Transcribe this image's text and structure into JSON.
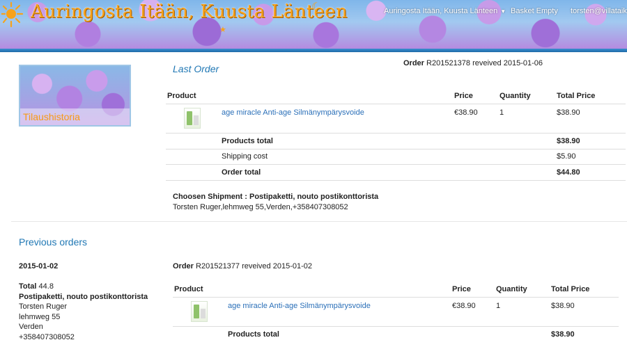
{
  "header": {
    "site_title": "Auringosta Itään, Kuusta Länteen",
    "nav_site": "Auringosta Itään, Kuusta Länteen",
    "nav_basket": "Basket Empty",
    "nav_user": "torsten@villataika.fi"
  },
  "sidebar": {
    "caption": "Tilaushistoria"
  },
  "last_order": {
    "title": "Last Order",
    "order_label": "Order",
    "order_text": "R201521378 reveived 2015-01-06",
    "columns": {
      "product": "Product",
      "price": "Price",
      "quantity": "Quantity",
      "total": "Total Price"
    },
    "items": [
      {
        "name": "age miracle Anti-age Silmänympärysvoide",
        "price": "€38.90",
        "quantity": "1",
        "total": "$38.90"
      }
    ],
    "products_total_label": "Products total",
    "products_total": "$38.90",
    "shipping_label": "Shipping cost",
    "shipping": "$5.90",
    "order_total_label": "Order total",
    "order_total": "$44.80",
    "shipment_label": "Choosen Shipment : Postipaketti, nouto postikonttorista",
    "shipment_address": "Torsten Ruger,lehmweg 55,Verden,+358407308052"
  },
  "previous": {
    "title": "Previous orders",
    "date": "2015-01-02",
    "total_label": "Total",
    "total_value": "44.8",
    "shipping_method": "Postipaketti, nouto postikonttorista",
    "address_lines": [
      "Torsten Ruger",
      "lehmweg 55",
      "Verden",
      "+358407308052"
    ],
    "order_label": "Order",
    "order_text": "R201521377 reveived 2015-01-02",
    "columns": {
      "product": "Product",
      "price": "Price",
      "quantity": "Quantity",
      "total": "Total Price"
    },
    "items": [
      {
        "name": "age miracle Anti-age Silmänympärysvoide",
        "price": "€38.90",
        "quantity": "1",
        "total": "$38.90"
      }
    ],
    "products_total_label": "Products total",
    "products_total": "$38.90"
  },
  "colors": {
    "accent": "#1f77b4",
    "title_orange": "#f7a21b",
    "stripe_blue": "#2a7fc0"
  }
}
